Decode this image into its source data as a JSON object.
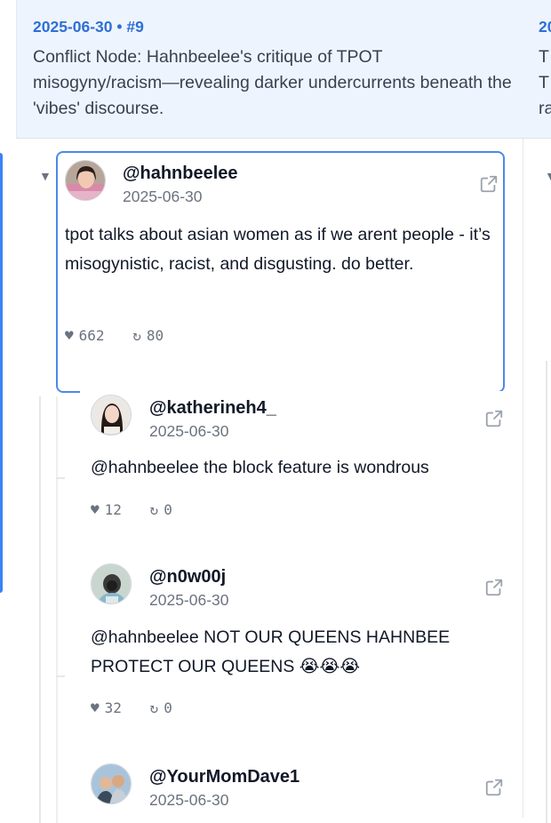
{
  "column": {
    "meta": "2025-06-30 • #9",
    "title": "Conflict Node: Hahnbeelee's critique of TPOT misogyny/racism—revealing darker undercurrents beneath the 'vibes' discourse."
  },
  "next_column": {
    "meta": "20",
    "title": "T\nT\nra"
  },
  "icons": {
    "caret": "▼",
    "like": "♥",
    "retweet": "↻",
    "external": "external-link-icon"
  },
  "tweets": [
    {
      "handle": "@hahnbeelee",
      "date": "2025-06-30",
      "text": "tpot talks about asian women as if we arent people - it’s misogynistic, racist, and disgusting. do better.",
      "likes": "662",
      "retweets": "80"
    },
    {
      "handle": "@katherineh4_",
      "date": "2025-06-30",
      "text": "@hahnbeelee the block feature is wondrous",
      "likes": "12",
      "retweets": "0"
    },
    {
      "handle": "@n0w00j",
      "date": "2025-06-30",
      "text": "@hahnbeelee NOT OUR QUEENS HAHNBEE PROTECT OUR QUEENS 😭😭😭",
      "likes": "32",
      "retweets": "0"
    },
    {
      "handle": "@YourMomDave1",
      "date": "2025-06-30"
    }
  ],
  "colors": {
    "accent": "#3b82f6",
    "header_bg": "#eef4fd",
    "meta_text": "#2f6fd6"
  }
}
